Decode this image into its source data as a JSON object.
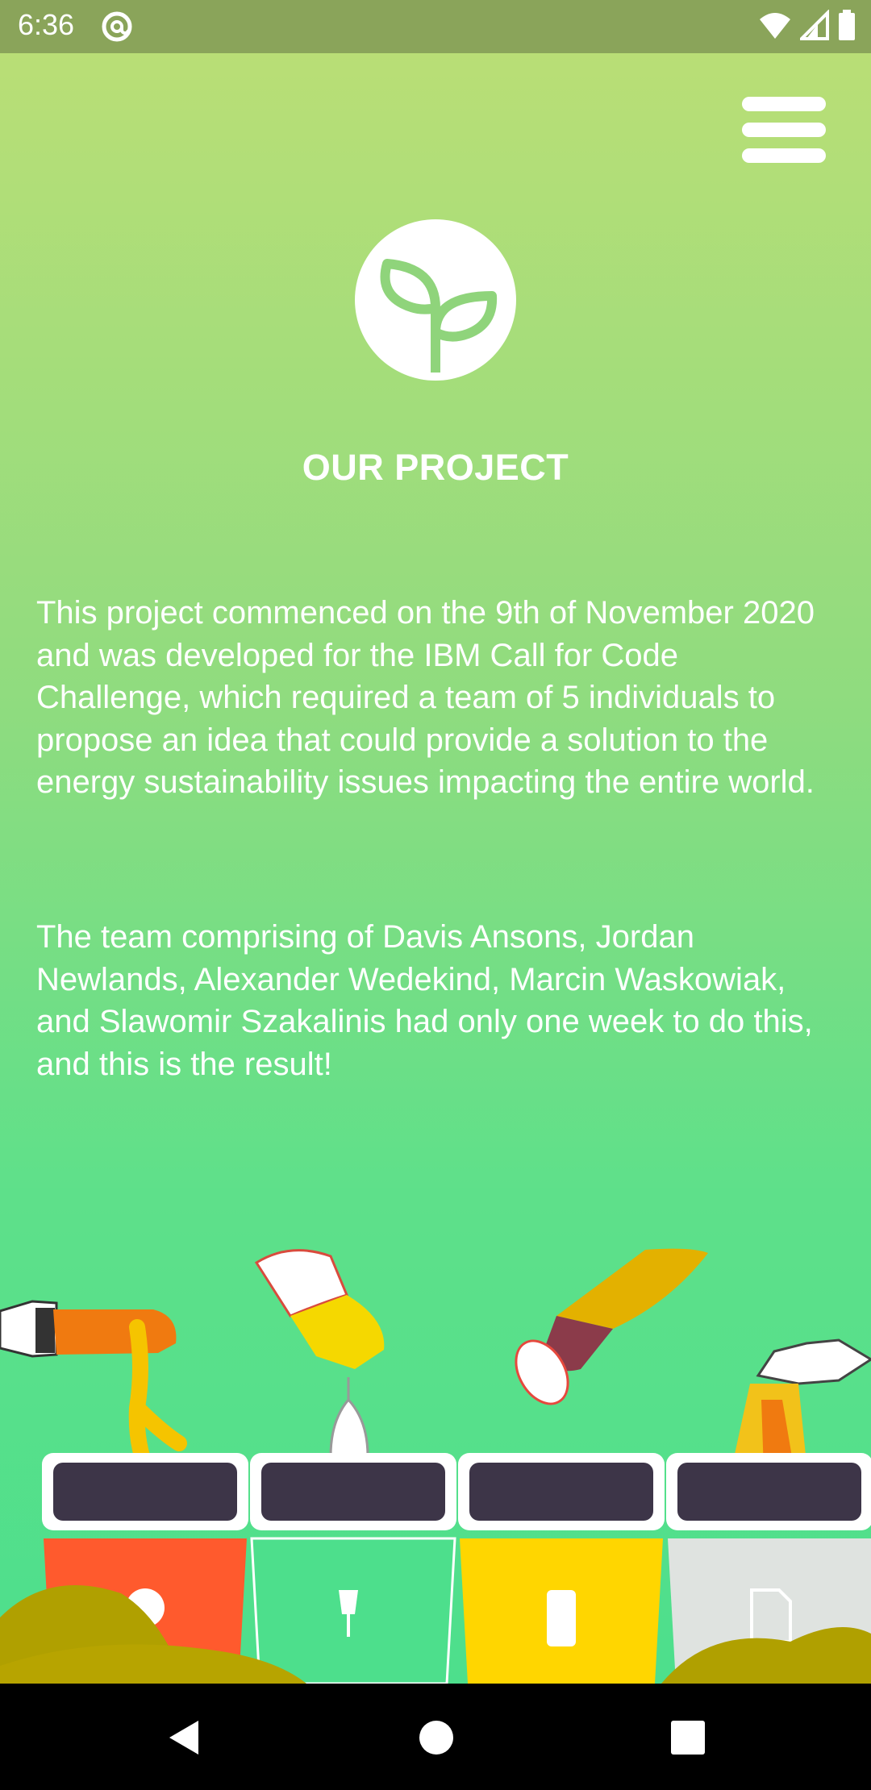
{
  "status_bar": {
    "time": "6:36",
    "icons": [
      "at-sign-icon",
      "wifi-icon",
      "signal-icon",
      "battery-icon"
    ]
  },
  "header": {
    "menu_icon": "hamburger-menu-icon"
  },
  "logo": {
    "icon": "sprout-icon"
  },
  "content": {
    "title": "OUR PROJECT",
    "paragraph_1": "This project commenced on the 9th of November 2020 and was developed for the IBM Call for Code Challenge, which required a team of 5 individuals to propose an idea that could provide a solution to the energy sustainability issues impacting the entire world.",
    "paragraph_2": "The team comprising of Davis Ansons, Jordan Newlands, Alexander Wedekind, Marcin Waskowiak, and Slawomir Szakalinis had only one week to do this, and this is the result!"
  },
  "illustration": {
    "bins": [
      "organic",
      "glass",
      "plastic",
      "paper"
    ],
    "bin_colors": [
      "#ff5a2d",
      "#4ddf8c",
      "#ffd600",
      "#dfe3e0"
    ]
  },
  "nav_bar": {
    "buttons": [
      "back-icon",
      "home-icon",
      "recents-icon"
    ]
  },
  "colors": {
    "status_bar": "#8aa45a",
    "gradient_top": "#b9de76",
    "gradient_bottom": "#4ddf8c",
    "text": "#ffffff"
  }
}
